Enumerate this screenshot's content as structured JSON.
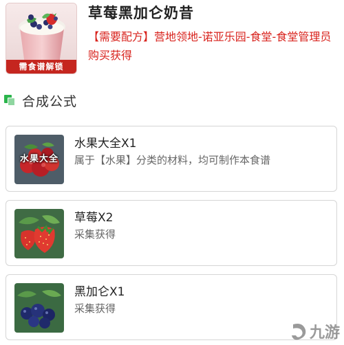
{
  "header": {
    "title": "草莓黑加仑奶昔",
    "source_text": "【需要配方】营地领地-诺亚乐园-食堂-食堂管理员购买获得",
    "thumb_banner": "需食谱解锁"
  },
  "section": {
    "title": "合成公式"
  },
  "ingredients": [
    {
      "name": "水果大全X1",
      "desc": "属于【水果】分类的材料，均可制作本食谱",
      "image_text": "水果大全",
      "icon": "mixed-fruit-icon"
    },
    {
      "name": "草莓X2",
      "desc": "采集获得",
      "icon": "strawberry-icon"
    },
    {
      "name": "黑加仑X1",
      "desc": "采集获得",
      "icon": "blackcurrant-icon"
    }
  ],
  "watermark": {
    "text": "九游"
  },
  "colors": {
    "accent_red": "#d8221c",
    "banner_red": "#c5261f",
    "section_green": "#2bb54c"
  }
}
